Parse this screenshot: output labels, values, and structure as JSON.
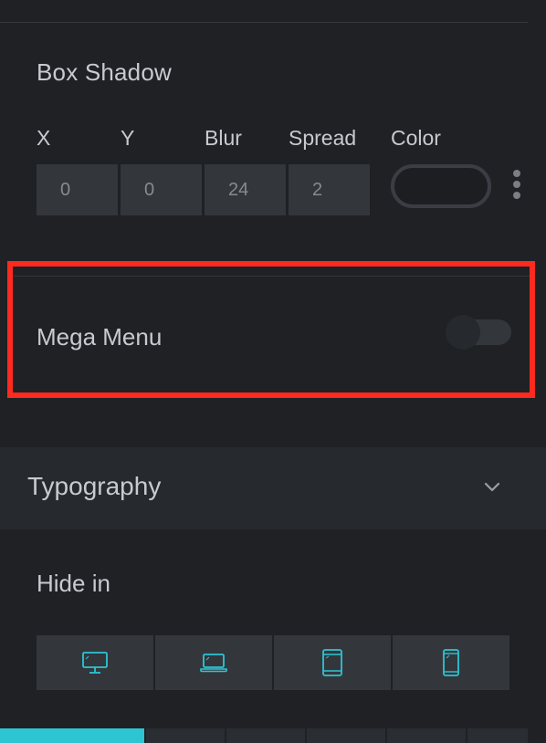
{
  "box_shadow": {
    "title": "Box Shadow",
    "labels": {
      "x": "X",
      "y": "Y",
      "blur": "Blur",
      "spread": "Spread",
      "color": "Color"
    },
    "values": {
      "x": "0",
      "y": "0",
      "blur": "24",
      "spread": "2"
    }
  },
  "mega_menu": {
    "label": "Mega Menu",
    "enabled": false
  },
  "typography": {
    "label": "Typography",
    "icon": "chevron-down-icon"
  },
  "hide_in": {
    "label": "Hide in",
    "devices": [
      {
        "name": "desktop",
        "icon": "desktop-icon"
      },
      {
        "name": "laptop",
        "icon": "laptop-icon"
      },
      {
        "name": "tablet",
        "icon": "tablet-icon"
      },
      {
        "name": "mobile",
        "icon": "mobile-icon"
      }
    ]
  },
  "colors": {
    "accent": "#2ec5d3",
    "highlight": "#ff2a1f",
    "panel_bg": "#1f2124"
  }
}
